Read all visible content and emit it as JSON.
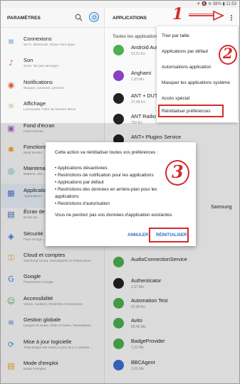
{
  "status": {
    "text": "✈ 🔇 ≋ 38% ▮ 11:53"
  },
  "settings": {
    "title": "PARAMÈTRES",
    "items": [
      {
        "title": "Connexions",
        "subtitle": "Wi-Fi, Bluetooth, Mode Hors-ligne",
        "icon": "wifi-icon",
        "color": "#4a90d9"
      },
      {
        "title": "Son",
        "subtitle": "Sons, Ne pas déranger",
        "icon": "speaker-icon",
        "color": "#e0569a"
      },
      {
        "title": "Notifications",
        "subtitle": "Bloquer, autoriser, prioriser",
        "icon": "bell-icon",
        "color": "#e0513a"
      },
      {
        "title": "Affichage",
        "subtitle": "Luminosité, Filtre de lumière bleue",
        "icon": "display-icon",
        "color": "#7cb342"
      },
      {
        "title": "Fond d'écran",
        "subtitle": "Fond d'écran",
        "icon": "image-icon",
        "color": "#a064c8"
      },
      {
        "title": "Fonctions",
        "subtitle": "Multi fenêtre",
        "icon": "star-icon",
        "color": "#f2a02a"
      },
      {
        "title": "Maintenance",
        "subtitle": "Batterie, Sto...",
        "icon": "maintenance-icon",
        "color": "#2bb5b5"
      },
      {
        "title": "Applications",
        "subtitle": "Applications",
        "icon": "apps-icon",
        "color": "#4a78d4"
      },
      {
        "title": "Écran de",
        "subtitle": "Écran de...",
        "icon": "lock-screen-icon",
        "color": "#3e6bc2"
      },
      {
        "title": "Sécurité",
        "subtitle": "Face recogn...",
        "icon": "shield-icon",
        "color": "#2a7fd4"
      },
      {
        "title": "Cloud et comptes",
        "subtitle": "Samsung Cloud, Sauvegarde et restauration",
        "icon": "key-icon",
        "color": "#f2a02a"
      },
      {
        "title": "Google",
        "subtitle": "Paramètres Google",
        "icon": "google-icon",
        "color": "#4285f4"
      },
      {
        "title": "Accessibilité",
        "subtitle": "Vision, Audition, Dextérité et interaction",
        "icon": "accessibility-icon",
        "color": "#5aa65a"
      },
      {
        "title": "Gestion globale",
        "subtitle": "Langue et saisie, Date et heure, Réinitialisat...",
        "icon": "sliders-icon",
        "color": "#5a7fd4"
      },
      {
        "title": "Mise à jour logicielle",
        "subtitle": "Télécharger les mises à jour, M.à.J. planifié...",
        "icon": "update-icon",
        "color": "#4aa0d4"
      },
      {
        "title": "Mode d'emploi",
        "subtitle": "Mode d'emploi",
        "icon": "manual-icon",
        "color": "#f2a02a"
      }
    ]
  },
  "apps": {
    "title": "APPLICATIONS",
    "filter_label": "Toutes les applications",
    "list": [
      {
        "name": "Android Auto",
        "size": "53,51 Ko",
        "color": "#4caf50"
      },
      {
        "name": "Anghami",
        "size": "1,93 Mo",
        "color": "#8a3fc6"
      },
      {
        "name": "ANT + DUT",
        "size": "37,48 Ko",
        "color": "#222222"
      },
      {
        "name": "ANT Radio Service",
        "size": "762 Ko",
        "color": "#222222"
      },
      {
        "name": "ANT+ Plugins Service",
        "size": "",
        "color": "#222222"
      },
      {
        "name": "AudioConnectionService",
        "size": "",
        "color": "#4caf50"
      },
      {
        "name": "Authenticator",
        "size": "1,37 Mo",
        "color": "#222222"
      },
      {
        "name": "Automation Test",
        "size": "52,89 Ko",
        "color": "#4caf50"
      },
      {
        "name": "Avito",
        "size": "69,45 Mo",
        "color": "#4caf50"
      },
      {
        "name": "BadgeProvider",
        "size": "1,31 Mo",
        "color": "#4caf50"
      },
      {
        "name": "BBCAgent",
        "size": "1,01 Mo",
        "color": "#3a6fd4"
      }
    ],
    "samsung_fragment": "Samsung"
  },
  "menu": {
    "items": [
      "Trier par taille",
      "Applications par défaut",
      "Autorisations application",
      "Masquer les applications système",
      "Accès spécial",
      "Réinitialiser préférences"
    ]
  },
  "dialog": {
    "intro": "Cette action va réinitialiser toutes vos préférences :",
    "lines": [
      "• Applications désactivées",
      "• Restrictions de notification pour les applications",
      "• Applications par défaut",
      "• Restrictions des données en arrière-plan pour les",
      "applications",
      "• Restrictions d'autorisation"
    ],
    "note": "Vous ne perdrez pas vos données d'application existantes.",
    "cancel": "ANNULER",
    "confirm": "RÉINITIALISER"
  },
  "annotations": {
    "step1": "1",
    "step2": "2",
    "step3": "3",
    "accent": "#d52a2a"
  }
}
